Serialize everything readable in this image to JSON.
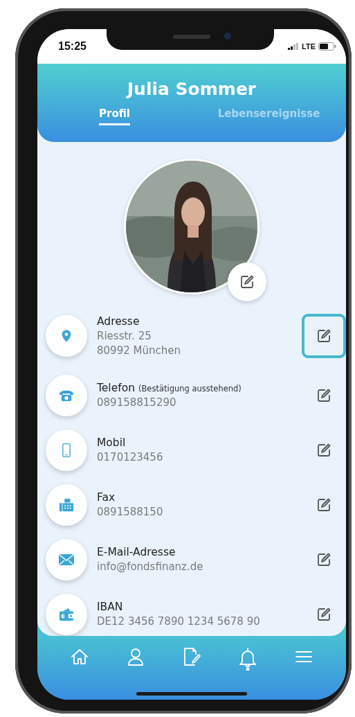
{
  "status_bar": {
    "time": "15:25",
    "network": "LTE"
  },
  "header": {
    "title": "Julia Sommer",
    "tabs": [
      {
        "label": "Profil",
        "selected": true
      },
      {
        "label": "Lebensereignisse",
        "selected": false
      }
    ]
  },
  "rows": [
    {
      "label": "Adresse",
      "values": [
        "Riesstr. 25",
        "80992 München"
      ],
      "highlighted": true
    },
    {
      "label": "Telefon",
      "note": "(Bestätigung ausstehend)",
      "values": [
        "089158815290"
      ],
      "highlighted": false
    },
    {
      "label": "Mobil",
      "values": [
        "0170123456"
      ],
      "highlighted": false
    },
    {
      "label": "Fax",
      "values": [
        "0891588150"
      ],
      "highlighted": false
    },
    {
      "label": "E-Mail-Adresse",
      "values": [
        "info@fondsfinanz.de"
      ],
      "highlighted": false
    },
    {
      "label": "IBAN",
      "values": [
        "DE12 3456 7890 1234 5678 90"
      ],
      "highlighted": false
    }
  ]
}
